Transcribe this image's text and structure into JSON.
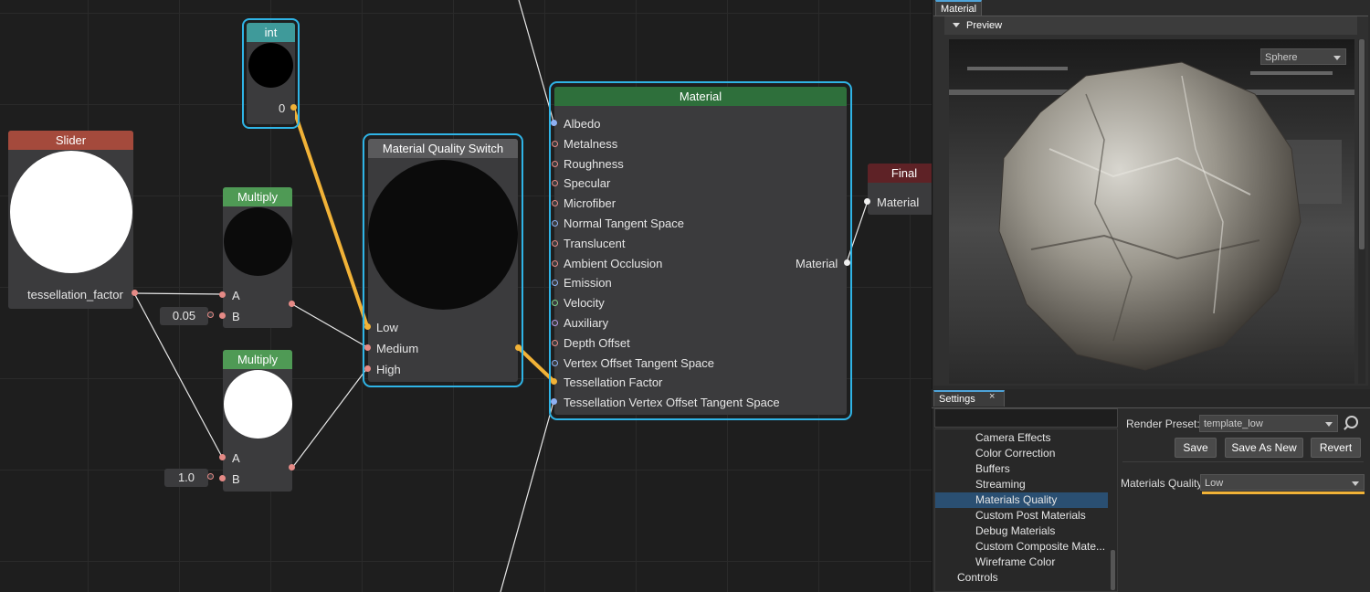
{
  "colors": {
    "accent_highlight": "#f1b237",
    "selection_outline": "#2fb4e6",
    "selected_tree_row": "#2a4f72"
  },
  "graph": {
    "slider_node": {
      "title": "Slider",
      "output_label": "tessellation_factor"
    },
    "multiply_node_1": {
      "title": "Multiply",
      "input_a": "A",
      "input_b": "B",
      "b_value": "0.05"
    },
    "multiply_node_2": {
      "title": "Multiply",
      "input_a": "A",
      "input_b": "B",
      "b_value": "1.0"
    },
    "int_node": {
      "title": "int",
      "value": "0"
    },
    "quality_switch_node": {
      "title": "Material Quality Switch",
      "inputs": [
        "Low",
        "Medium",
        "High"
      ]
    },
    "material_node": {
      "title": "Material",
      "inputs": [
        "Albedo",
        "Metalness",
        "Roughness",
        "Specular",
        "Microfiber",
        "Normal Tangent Space",
        "Translucent",
        "Ambient Occlusion",
        "Emission",
        "Velocity",
        "Auxiliary",
        "Depth Offset",
        "Vertex Offset Tangent Space",
        "Tessellation Factor",
        "Tessellation Vertex Offset Tangent Space"
      ],
      "output": "Material"
    },
    "final_node": {
      "title": "Final",
      "input": "Material"
    }
  },
  "panel": {
    "material_tab": "Material",
    "preview_section": "Preview",
    "preview_shape": "Sphere",
    "settings_tab": "Settings",
    "settings_tab_close": "×",
    "render_preset_label": "Render Preset:",
    "render_preset_value": "template_low",
    "save_button": "Save",
    "save_as_new_button": "Save As New",
    "revert_button": "Revert",
    "materials_quality_label": "Materials Quality",
    "materials_quality_value": "Low",
    "search_value": "",
    "tree_items": [
      "Camera Effects",
      "Color Correction",
      "Buffers",
      "Streaming",
      "Materials Quality",
      "Custom Post Materials",
      "Debug Materials",
      "Custom Composite Mate...",
      "Wireframe Color"
    ],
    "tree_selected_index": 4,
    "tree_parent_item": "Controls"
  }
}
